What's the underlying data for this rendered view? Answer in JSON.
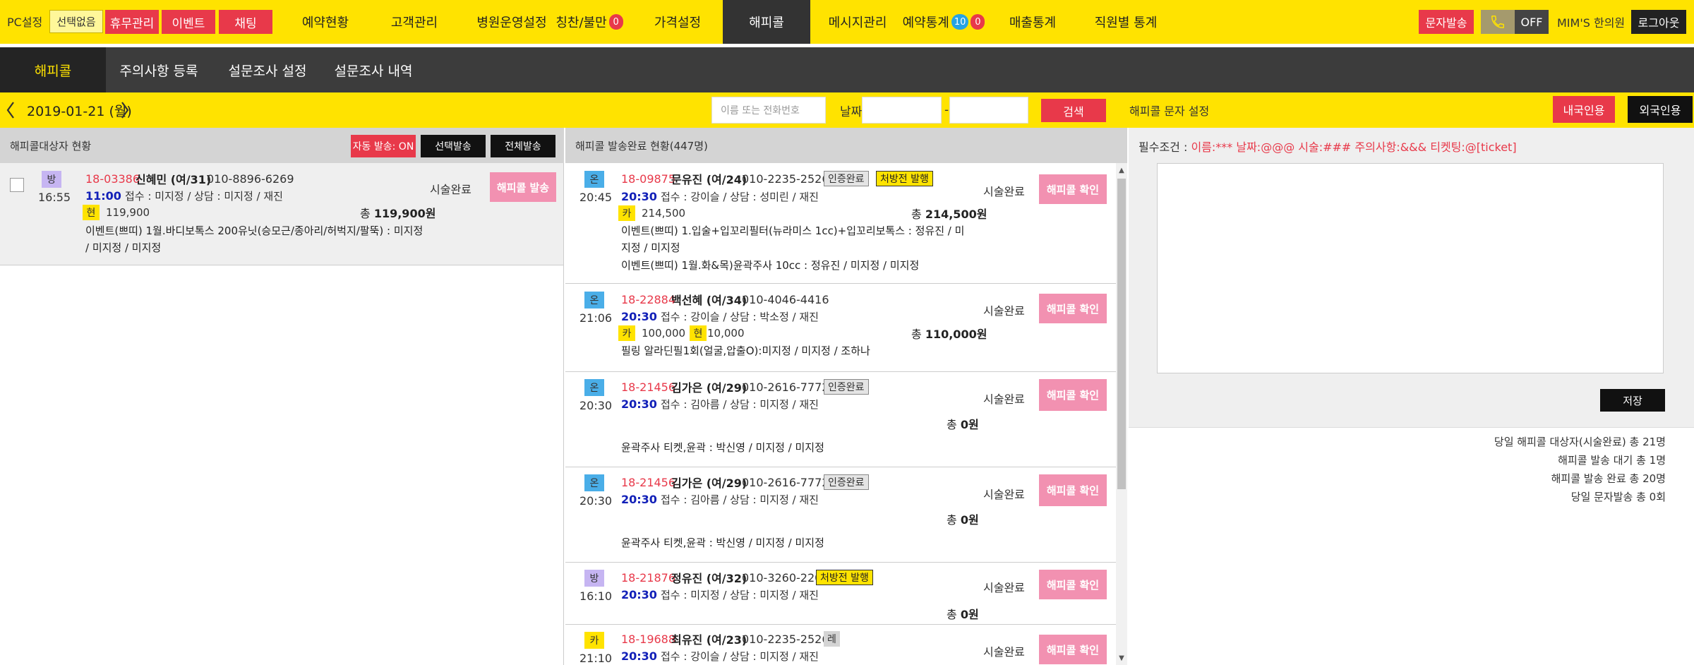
{
  "topbar": {
    "pc_label": "PC설정",
    "select_none": "선택없음",
    "red_buttons": [
      "휴무관리",
      "이벤트",
      "채팅"
    ],
    "nav": [
      {
        "label": "예약현황"
      },
      {
        "label": "고객관리"
      },
      {
        "label": "병원운영설정"
      },
      {
        "label": "칭찬/불만",
        "badge": "0"
      },
      {
        "label": "가격설정"
      },
      {
        "label": "해피콜",
        "active": true
      },
      {
        "label": "메시지관리"
      },
      {
        "label": "예약통계",
        "badge_blue": "10",
        "badge": "0"
      },
      {
        "label": "매출통계"
      },
      {
        "label": "직원별 통계"
      }
    ],
    "sms_button": "문자발송",
    "phone_icon": "phone-icon",
    "off_label": "OFF",
    "user_label": "MIM'S 한의원",
    "logout": "로그아웃"
  },
  "subnav": {
    "tabs": [
      "해피콜",
      "주의사항 등록",
      "설문조사 설정",
      "설문조사 내역"
    ],
    "active_index": 0
  },
  "datebar": {
    "date": "2019-01-21 (월)",
    "search_placeholder": "이름 또는 전화번호",
    "date_label": "날짜",
    "date_from": "",
    "date_to": "",
    "date_sep": "-",
    "search_button": "검색",
    "settings_title": "해피콜 문자 설정",
    "domestic_button": "내국인용",
    "foreign_button": "외국인용"
  },
  "left": {
    "title": "해피콜대상자 현황",
    "auto_button": "자동 발송: ON",
    "select_send": "선택발송",
    "all_send": "전체발송",
    "rows": [
      {
        "type": "방",
        "time": "16:55",
        "id": "18-03386",
        "name": "신혜민 (여/31)",
        "phone": "010-8896-6269",
        "appt": "11:00",
        "info": "접수 : 미지정 / 상담 : 미지정 / 재진",
        "pay_label": "현",
        "pay_amount": "119,900",
        "total_label": "총",
        "total": "119,900원",
        "desc": "이벤트(쁘띠) 1월.바디보톡스 200유닛(승모근/종아리/허벅지/팔뚝) : 미지정 / 미지정 / 미지정",
        "status": "시술완료",
        "button": "해피콜 발송"
      }
    ]
  },
  "middle": {
    "title": "해피콜 발송완료 현황(447명)",
    "rows": [
      {
        "type": "온",
        "time": "20:45",
        "id": "18-09875",
        "name": "문유진 (여/24)",
        "phone": "010-2235-2526",
        "tags": [
          "인증완료",
          "처방전 발행"
        ],
        "appt": "20:30",
        "info": "접수 : 강이슬 / 상담 : 성미린 / 재진",
        "pays": [
          {
            "label": "카",
            "amount": "214,500"
          }
        ],
        "total_label": "총",
        "total": "214,500원",
        "desc": "이벤트(쁘띠) 1.입술+입꼬리필터(뉴라미스 1cc)+입꼬리보톡스 : 정유진 / 미지정 / 미지정",
        "desc2": "이벤트(쁘띠) 1월.화&목)윤곽주사 10cc : 정유진 / 미지정 / 미지정",
        "status": "시술완료",
        "button": "해피콜 확인"
      },
      {
        "type": "온",
        "time": "21:06",
        "id": "18-22884",
        "name": "백선혜 (여/34)",
        "phone": "010-4046-4416",
        "tags": [],
        "appt": "20:30",
        "info": "접수 : 강이슬 / 상담 : 박소정 / 재진",
        "pays": [
          {
            "label": "카",
            "amount": "100,000"
          },
          {
            "label": "현",
            "amount": "10,000"
          }
        ],
        "total_label": "총",
        "total": "110,000원",
        "desc": "필링 알라딘필1회(얼굴,압출O):미지정 / 미지정 / 조하나",
        "status": "시술완료",
        "button": "해피콜 확인"
      },
      {
        "type": "온",
        "time": "20:30",
        "id": "18-21456",
        "name": "김가은 (여/29)",
        "phone": "010-2616-7772",
        "tags": [
          "인증완료"
        ],
        "appt": "20:30",
        "info": "접수 : 김아름 / 상담 : 미지정 / 재진",
        "total_label": "총",
        "total": "0원",
        "desc": "윤곽주사 티켓,윤곽 : 박신영 / 미지정 / 미지정",
        "status": "시술완료",
        "button": "해피콜 확인"
      },
      {
        "type": "온",
        "time": "20:30",
        "id": "18-21456",
        "name": "김가은 (여/29)",
        "phone": "010-2616-7772",
        "tags": [
          "인증완료"
        ],
        "appt": "20:30",
        "info": "접수 : 김아름 / 상담 : 미지정 / 재진",
        "total_label": "총",
        "total": "0원",
        "desc": "윤곽주사 티켓,윤곽 : 박신영 / 미지정 / 미지정",
        "status": "시술완료",
        "button": "해피콜 확인"
      },
      {
        "type": "방",
        "time": "16:10",
        "id": "18-21876",
        "name": "정유진 (여/32)",
        "phone": "010-3260-2202",
        "tags": [
          "처방전 발행"
        ],
        "appt": "20:30",
        "info": "접수 : 미지정 / 상담 : 미지정 / 재진",
        "total_label": "총",
        "total": "0원",
        "status": "시술완료",
        "button": "해피콜 확인"
      },
      {
        "type": "카",
        "time": "21:10",
        "id": "18-19688",
        "name": "최유진 (여/23)",
        "phone": "010-2235-2526",
        "tags": [
          "레"
        ],
        "appt": "20:30",
        "info": "접수 : 강이슬 / 상담 : 미지정 / 재진",
        "status": "시술완료",
        "button": "해피콜 확인"
      }
    ]
  },
  "right": {
    "cond_label": "필수조건 :",
    "cond_value": "이름:*** 날짜:@@@ 시술:### 주의사항:&&& 티켓팅:@[ticket]",
    "message_text": "",
    "save_button": "저장",
    "stats": [
      "당일 해피콜 대상자(시술완료) 총 21명",
      "해피콜 발송 대기 총 1명",
      "해피콜 발송 완료 총 20명",
      "당일 문자발송 총 0회"
    ]
  },
  "colors": {
    "yellow": "#ffe300",
    "red": "#e8394a",
    "pink": "#f291b1",
    "dark": "#3c3c3c",
    "blue_appt": "#1220b8"
  }
}
